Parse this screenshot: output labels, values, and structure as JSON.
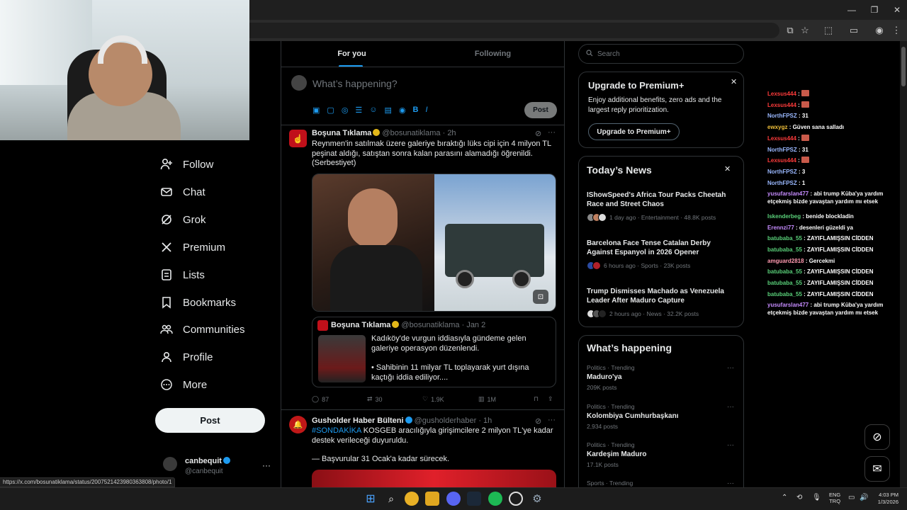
{
  "browser": {
    "minimize": "—",
    "restore": "❐",
    "close": "✕"
  },
  "sidebar": {
    "items": [
      {
        "label": "Follow",
        "icon": "add-user-icon"
      },
      {
        "label": "Chat",
        "icon": "envelope-icon"
      },
      {
        "label": "Grok",
        "icon": "grok-icon"
      },
      {
        "label": "Premium",
        "icon": "x-logo-icon"
      },
      {
        "label": "Lists",
        "icon": "list-icon"
      },
      {
        "label": "Bookmarks",
        "icon": "bookmark-icon"
      },
      {
        "label": "Communities",
        "icon": "communities-icon"
      },
      {
        "label": "Profile",
        "icon": "profile-icon"
      },
      {
        "label": "More",
        "icon": "more-circle-icon"
      }
    ],
    "post_label": "Post",
    "account": {
      "name": "canbequit",
      "handle": "@canbequit"
    }
  },
  "timeline": {
    "tabs": [
      "For you",
      "Following"
    ],
    "composer_placeholder": "What’s happening?",
    "composer_post": "Post",
    "tweet1": {
      "author": "Boşuna Tıklama",
      "handle": "@bosunatiklama",
      "time": "· 2h",
      "text": "Reynmen'in satılmak üzere galeriye bıraktığı lüks cipi için 4 milyon TL peşinat aldığı, satıştan sonra kalan parasını alamadığı öğrenildi. (Serbestiyet)",
      "quote": {
        "author": "Boşuna Tıklama",
        "handle": "@bosunatiklama",
        "time": "· Jan 2",
        "text1": "Kadıköy'de vurgun iddiasıyla gündeme gelen galeriye operasyon düzenlendi.",
        "text2": "• Sahibinin 11 milyar TL toplayarak yurt dışına kaçtığı iddia ediliyor...."
      },
      "replies": "87",
      "reposts": "30",
      "likes": "1.9K",
      "views": "1M"
    },
    "tweet2": {
      "author": "Gusholder Haber Bülteni",
      "handle": "@gusholderhaber",
      "time": "· 1h",
      "hashtag": "#SONDAKİKA",
      "text": " KOSGEB aracılığıyla girişimcilere 2 milyon TL'ye kadar destek verileceği duyuruldu.",
      "text2": "— Başvurular 31 Ocak'a kadar sürecek."
    }
  },
  "right": {
    "search_placeholder": "Search",
    "premium": {
      "title": "Upgrade to Premium+",
      "desc": "Enjoy additional benefits, zero ads and the largest reply prioritization.",
      "button": "Upgrade to Premium+"
    },
    "news": {
      "title": "Today’s News",
      "items": [
        {
          "title": "IShowSpeed's Africa Tour Packs Cheetah Race and Street Chaos",
          "meta": "1 day ago · Entertainment · 48.8K posts"
        },
        {
          "title": "Barcelona Face Tense Catalan Derby Against Espanyol in 2026 Opener",
          "meta": "6 hours ago · Sports · 23K posts"
        },
        {
          "title": "Trump Dismisses Machado as Venezuela Leader After Maduro Capture",
          "meta": "2 hours ago · News · 32.2K posts"
        }
      ]
    },
    "happening": {
      "title": "What’s happening",
      "items": [
        {
          "cat": "Politics · Trending",
          "name": "Maduro'ya",
          "posts": "209K posts"
        },
        {
          "cat": "Politics · Trending",
          "name": "Kolombiya Cumhurbaşkanı",
          "posts": "2,934 posts"
        },
        {
          "cat": "Politics · Trending",
          "name": "Kardeşim Maduro",
          "posts": "17.1K posts"
        },
        {
          "cat": "Sports · Trending",
          "name": "",
          "posts": ""
        }
      ]
    }
  },
  "chat": [
    {
      "user": "Lexsus444",
      "msg": "",
      "color": "#ff3b3b",
      "emote": true
    },
    {
      "user": "Lexsus444",
      "msg": "",
      "color": "#ff3b3b",
      "emote": true
    },
    {
      "user": "NorthFPSZ",
      "msg": " : 31",
      "color": "#9ab8ff"
    },
    {
      "user": "ewxygz",
      "msg": " : Güven sana salladı",
      "color": "#f0c03a"
    },
    {
      "user": "Lexsus444",
      "msg": "",
      "color": "#ff3b3b",
      "emote": true
    },
    {
      "user": "NorthFPSZ",
      "msg": " : 31",
      "color": "#9ab8ff"
    },
    {
      "user": "Lexsus444",
      "msg": "",
      "color": "#ff3b3b",
      "emote": true
    },
    {
      "user": "NorthFPSZ",
      "msg": " : 3",
      "color": "#9ab8ff"
    },
    {
      "user": "NorthFPSZ",
      "msg": " : 1",
      "color": "#9ab8ff"
    },
    {
      "user": "yusufarslan477",
      "msg": " : abi trump Küba'ya yardım etçekmiş bizde yavaştan yardım mı etsek",
      "color": "#c68cff",
      "two": true
    },
    {
      "user": "Iskenderbeg",
      "msg": " : benide blockladin",
      "color": "#5ad17a"
    },
    {
      "user": "Erennzi77",
      "msg": " : desenleri güzeldi ya",
      "color": "#c68cff"
    },
    {
      "user": "batubaba_55",
      "msg": " : ZAYIFLAMIŞSIN CİDDEN",
      "color": "#5ad17a"
    },
    {
      "user": "batubaba_55",
      "msg": " : ZAYIFLAMIŞSIN CİDDEN",
      "color": "#5ad17a"
    },
    {
      "user": "amguard2818",
      "msg": " : Gercekmi",
      "color": "#ff9ab0"
    },
    {
      "user": "batubaba_55",
      "msg": " : ZAYIFLAMIŞSIN CİDDEN",
      "color": "#5ad17a"
    },
    {
      "user": "batubaba_55",
      "msg": " : ZAYIFLAMIŞSIN CİDDEN",
      "color": "#5ad17a"
    },
    {
      "user": "batubaba_55",
      "msg": " : ZAYIFLAMIŞSIN CİDDEN",
      "color": "#5ad17a"
    },
    {
      "user": "yusufarslan477",
      "msg": " : abi trump Küba'ya yardım etçekmiş bizde yavaştan yardım mı etsek",
      "color": "#c68cff",
      "two": true
    }
  ],
  "status_url": "https://x.com/bosunatiklama/status/2007521423980363808/photo/1",
  "taskbar": {
    "lang1": "ENG",
    "lang2": "TRQ",
    "time": "4:03 PM",
    "date": "1/3/2026"
  }
}
